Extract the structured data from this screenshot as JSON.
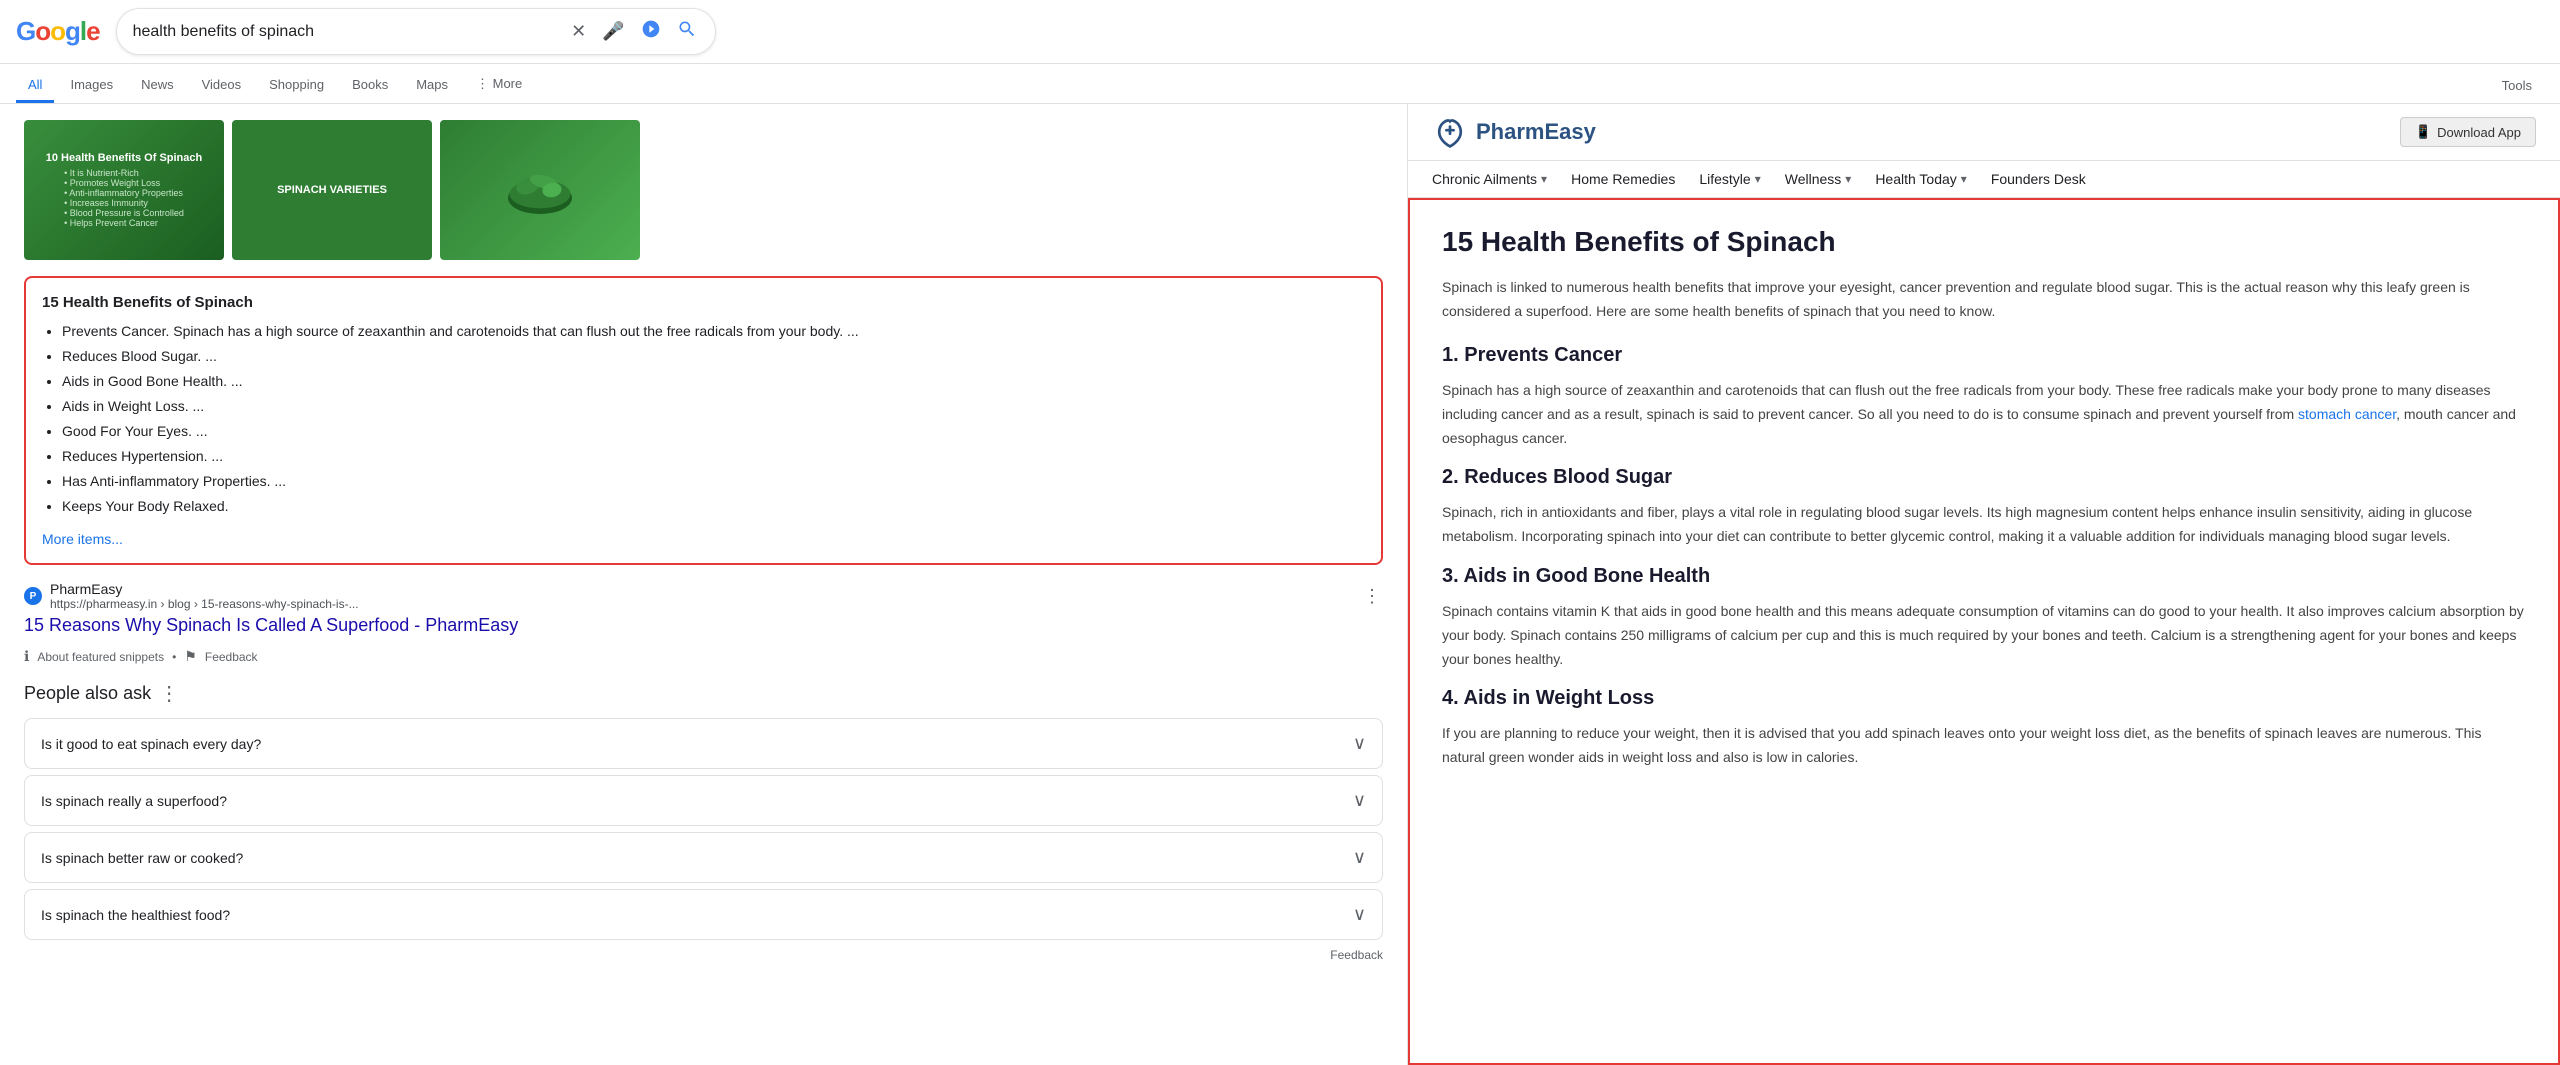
{
  "google": {
    "logo_text": "Google",
    "search_query": "health benefits of spinach",
    "search_placeholder": "health benefits of spinach",
    "nav_tabs": [
      {
        "label": "All",
        "active": true
      },
      {
        "label": "Images",
        "active": false
      },
      {
        "label": "News",
        "active": false
      },
      {
        "label": "Videos",
        "active": false
      },
      {
        "label": "Shopping",
        "active": false
      },
      {
        "label": "Books",
        "active": false
      },
      {
        "label": "Maps",
        "active": false
      },
      {
        "label": "More",
        "active": false
      }
    ],
    "tools_label": "Tools"
  },
  "featured_snippet": {
    "title": "15 Health Benefits of Spinach",
    "items": [
      "Prevents Cancer. Spinach has a high source of zeaxanthin and carotenoids that can flush out the free radicals from your body. ...",
      "Reduces Blood Sugar. ...",
      "Aids in Good Bone Health. ...",
      "Aids in Weight Loss. ...",
      "Good For Your Eyes. ...",
      "Reduces Hypertension. ...",
      "Has Anti-inflammatory Properties. ...",
      "Keeps Your Body Relaxed."
    ],
    "more_items_link": "More items..."
  },
  "search_result": {
    "source_name": "PharmEasy",
    "source_url": "https://pharmeasy.in › blog › 15-reasons-why-spinach-is-...",
    "result_title": "15 Reasons Why Spinach Is Called A Superfood - PharmEasy",
    "favicon_letter": "P"
  },
  "snippet_footer": {
    "about_snippets": "About featured snippets",
    "feedback": "Feedback"
  },
  "images": {
    "image1_title": "10 Health Benefits Of Spinach",
    "image1_items": [
      "• It is Nutrient-Rich",
      "• Promotes Weight Loss",
      "• Anti-inflammatory Properties",
      "• Increases Immunity",
      "• Blood Pressure is Controlled",
      "• Helps Prevent Cancer"
    ],
    "image2_label": "SPINACH VARIETIES"
  },
  "people_also_ask": {
    "section_title": "People also ask",
    "questions": [
      "Is it good to eat spinach every day?",
      "Is spinach really a superfood?",
      "Is spinach better raw or cooked?",
      "Is spinach the healthiest food?"
    ],
    "feedback_label": "Feedback"
  },
  "pharmeasy": {
    "logo_name": "PharmEasy",
    "download_btn_label": "Download App",
    "nav_items": [
      {
        "label": "Chronic Ailments",
        "has_chevron": true
      },
      {
        "label": "Home Remedies",
        "has_chevron": false
      },
      {
        "label": "Lifestyle",
        "has_chevron": true
      },
      {
        "label": "Wellness",
        "has_chevron": true
      },
      {
        "label": "Health Today",
        "has_chevron": true
      },
      {
        "label": "Founders Desk",
        "has_chevron": false
      }
    ]
  },
  "article": {
    "title": "15 Health Benefits of Spinach",
    "intro": "Spinach is linked to numerous health benefits that improve your eyesight, cancer prevention and regulate blood sugar. This is the actual reason why this leafy green is considered a superfood. Here are some health benefits of spinach that you need to know.",
    "sections": [
      {
        "number": "1.",
        "title": "Prevents Cancer",
        "text": "Spinach has a high source of zeaxanthin and carotenoids that can flush out the free radicals from your body. These free radicals make your body prone to many diseases including cancer and as a result, spinach is said to prevent cancer. So all you need to do is to consume spinach and prevent yourself from stomach cancer, mouth cancer and oesophagus cancer.",
        "has_link": true,
        "link_text": "stomach cancer",
        "link_position": "from "
      },
      {
        "number": "2.",
        "title": "Reduces Blood Sugar",
        "text": "Spinach, rich in antioxidants and fiber, plays a vital role in regulating blood sugar levels. Its high magnesium content helps enhance insulin sensitivity, aiding in glucose metabolism. Incorporating spinach into your diet can contribute to better glycemic control, making it a valuable addition for individuals managing blood sugar levels.",
        "has_link": false
      },
      {
        "number": "3.",
        "title": "Aids in Good Bone Health",
        "text": "Spinach contains vitamin K that aids in good bone health and this means adequate consumption of vitamins can do good to your health. It also improves calcium absorption by your body. Spinach contains 250 milligrams of calcium per cup and this is much required by your bones and teeth. Calcium is a strengthening agent for your bones and keeps your bones healthy.",
        "has_link": false
      },
      {
        "number": "4.",
        "title": "Aids in Weight Loss",
        "text": "If you are planning to reduce your weight, then it is advised that you add spinach leaves onto your weight loss diet, as the benefits of spinach leaves are numerous. This natural green wonder aids in weight loss and also is low in calories.",
        "has_link": false
      }
    ]
  }
}
